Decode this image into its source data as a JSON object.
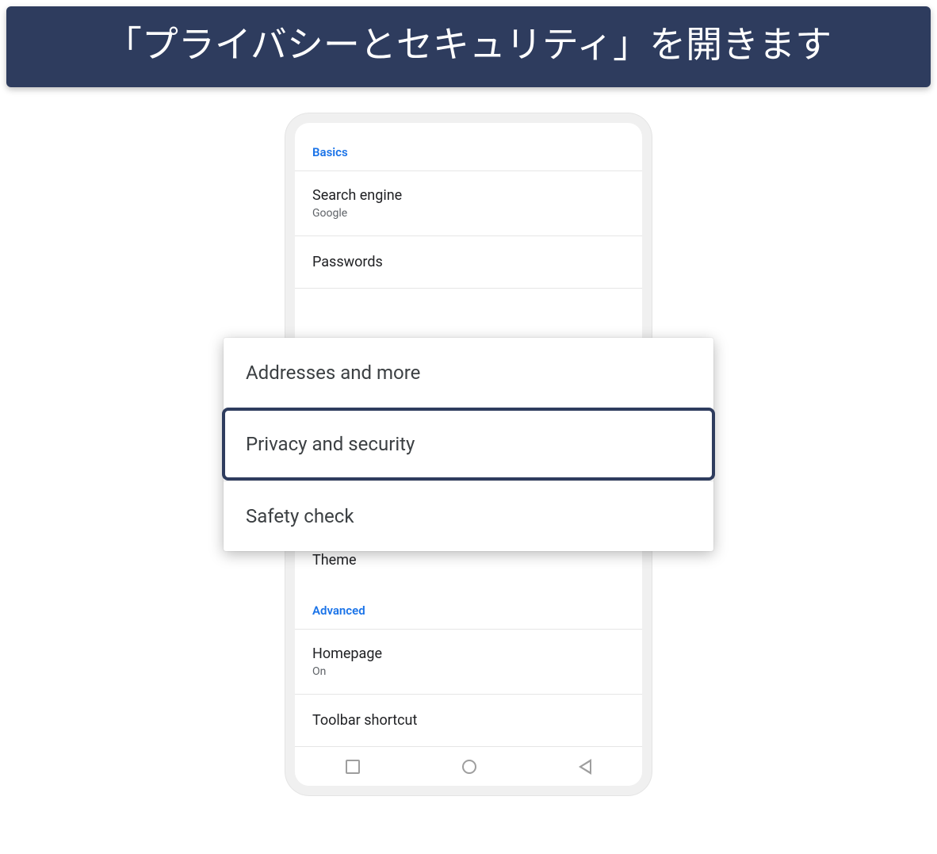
{
  "banner": {
    "text": "「プライバシーとセキュリティ」を開きます"
  },
  "sections": {
    "basics": {
      "header": "Basics",
      "items": {
        "search_engine": {
          "title": "Search engine",
          "sub": "Google"
        },
        "passwords": {
          "title": "Passwords"
        },
        "theme": {
          "title": "Theme"
        }
      }
    },
    "advanced": {
      "header": "Advanced",
      "items": {
        "homepage": {
          "title": "Homepage",
          "sub": "On"
        },
        "toolbar_shortcut": {
          "title": "Toolbar shortcut"
        }
      }
    }
  },
  "callout": {
    "addresses": "Addresses and more",
    "privacy": "Privacy and security",
    "safety": "Safety check"
  }
}
